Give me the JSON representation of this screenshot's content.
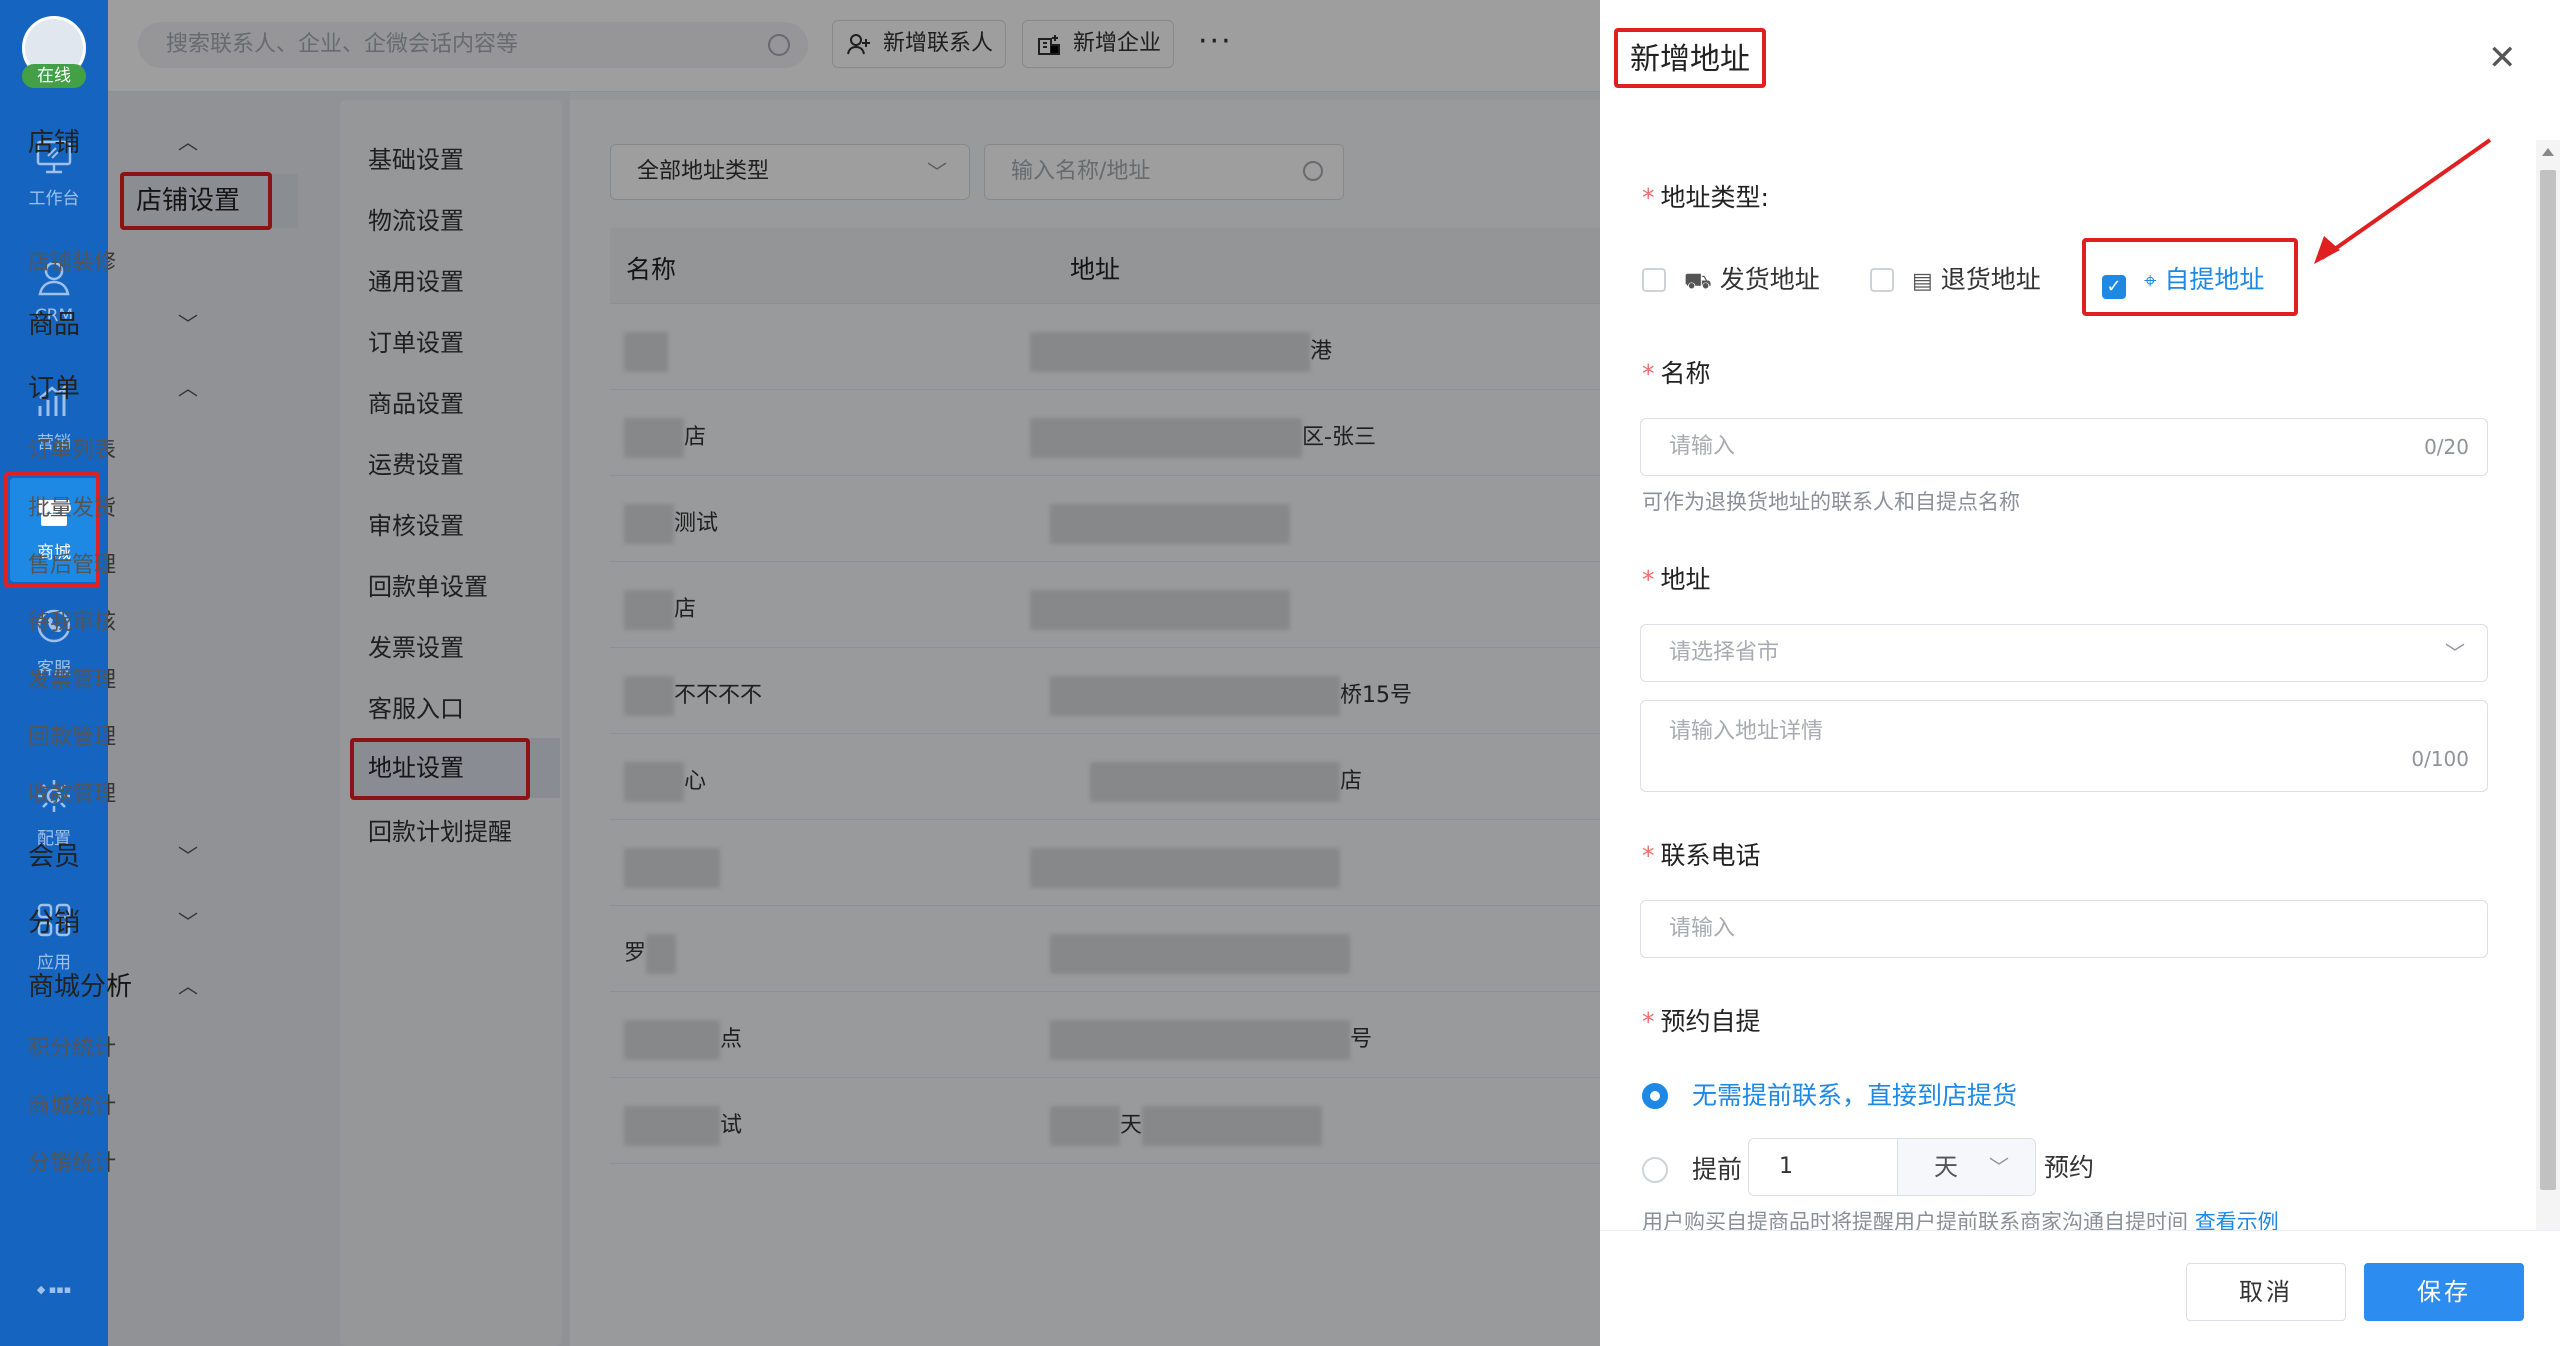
{
  "rail": {
    "online": "在线",
    "items": [
      {
        "label": "工作台",
        "icon": "workbench-icon"
      },
      {
        "label": "CRM",
        "icon": "crm-icon"
      },
      {
        "label": "营销",
        "icon": "marketing-icon"
      },
      {
        "label": "商城",
        "icon": "store-icon"
      },
      {
        "label": "客服",
        "icon": "service-icon"
      },
      {
        "label": "配置",
        "icon": "config-icon"
      },
      {
        "label": "应用",
        "icon": "apps-icon"
      }
    ]
  },
  "topbar": {
    "search_placeholder": "搜索联系人、企业、企微会话内容等",
    "add_contact": "新增联系人",
    "add_company": "新增企业",
    "more": "···"
  },
  "menu": {
    "groups": [
      {
        "label": "店铺",
        "expanded": true
      },
      {
        "label": "商品",
        "expanded": false
      },
      {
        "label": "订单",
        "expanded": true
      },
      {
        "label": "会员",
        "expanded": false
      },
      {
        "label": "分销",
        "expanded": false
      },
      {
        "label": "商城分析",
        "expanded": true
      }
    ],
    "items": [
      "店铺设置",
      "店铺装修",
      "订单列表",
      "批量发货",
      "售后管理",
      "待我审核",
      "发票管理",
      "回款管理",
      "收款管理",
      "积分统计",
      "商城统计",
      "分销统计"
    ]
  },
  "settings": {
    "items": [
      "基础设置",
      "物流设置",
      "通用设置",
      "订单设置",
      "商品设置",
      "运费设置",
      "审核设置",
      "回款单设置",
      "发票设置",
      "客服入口",
      "地址设置",
      "回款计划提醒"
    ]
  },
  "content": {
    "type_filter": "全部地址类型",
    "name_filter_placeholder": "输入名称/地址",
    "columns": [
      "名称",
      "地址"
    ],
    "rows": [
      {
        "name": "",
        "address": "港"
      },
      {
        "name": "店",
        "address": "区-张三"
      },
      {
        "name": "测试",
        "address": ""
      },
      {
        "name": "店",
        "address": ""
      },
      {
        "name": "不不不不",
        "address": "桥15号"
      },
      {
        "name": "心",
        "address": "店"
      },
      {
        "name": "",
        "address": ""
      },
      {
        "name": "罗",
        "address": ""
      },
      {
        "name": "点",
        "address": "号"
      },
      {
        "name": "试",
        "address": "天"
      }
    ]
  },
  "drawer": {
    "title": "新增地址",
    "type_label": "地址类型:",
    "types": [
      {
        "label": "发货地址",
        "checked": false
      },
      {
        "label": "退货地址",
        "checked": false
      },
      {
        "label": "自提地址",
        "checked": true
      }
    ],
    "name_label": "名称",
    "name_placeholder": "请输入",
    "name_count": "0/20",
    "name_hint": "可作为退换货地址的联系人和自提点名称",
    "address_label": "地址",
    "region_placeholder": "请选择省市",
    "detail_placeholder": "请输入地址详情",
    "detail_count": "0/100",
    "phone_label": "联系电话",
    "phone_placeholder": "请输入",
    "reserve_label": "预约自提",
    "reserve_option1": "无需提前联系，直接到店提货",
    "reserve_option2_prefix": "提前",
    "reserve_days": "1",
    "reserve_unit": "天",
    "reserve_option2_suffix": "预约",
    "reserve_note": "用户购买自提商品时将提醒用户提前联系商家沟通自提时间",
    "reserve_note_link": "查看示例",
    "cancel": "取消",
    "save": "保存"
  },
  "colors": {
    "primary": "#1e88e5",
    "highlight": "#e02020",
    "rail": "#1565c0"
  }
}
